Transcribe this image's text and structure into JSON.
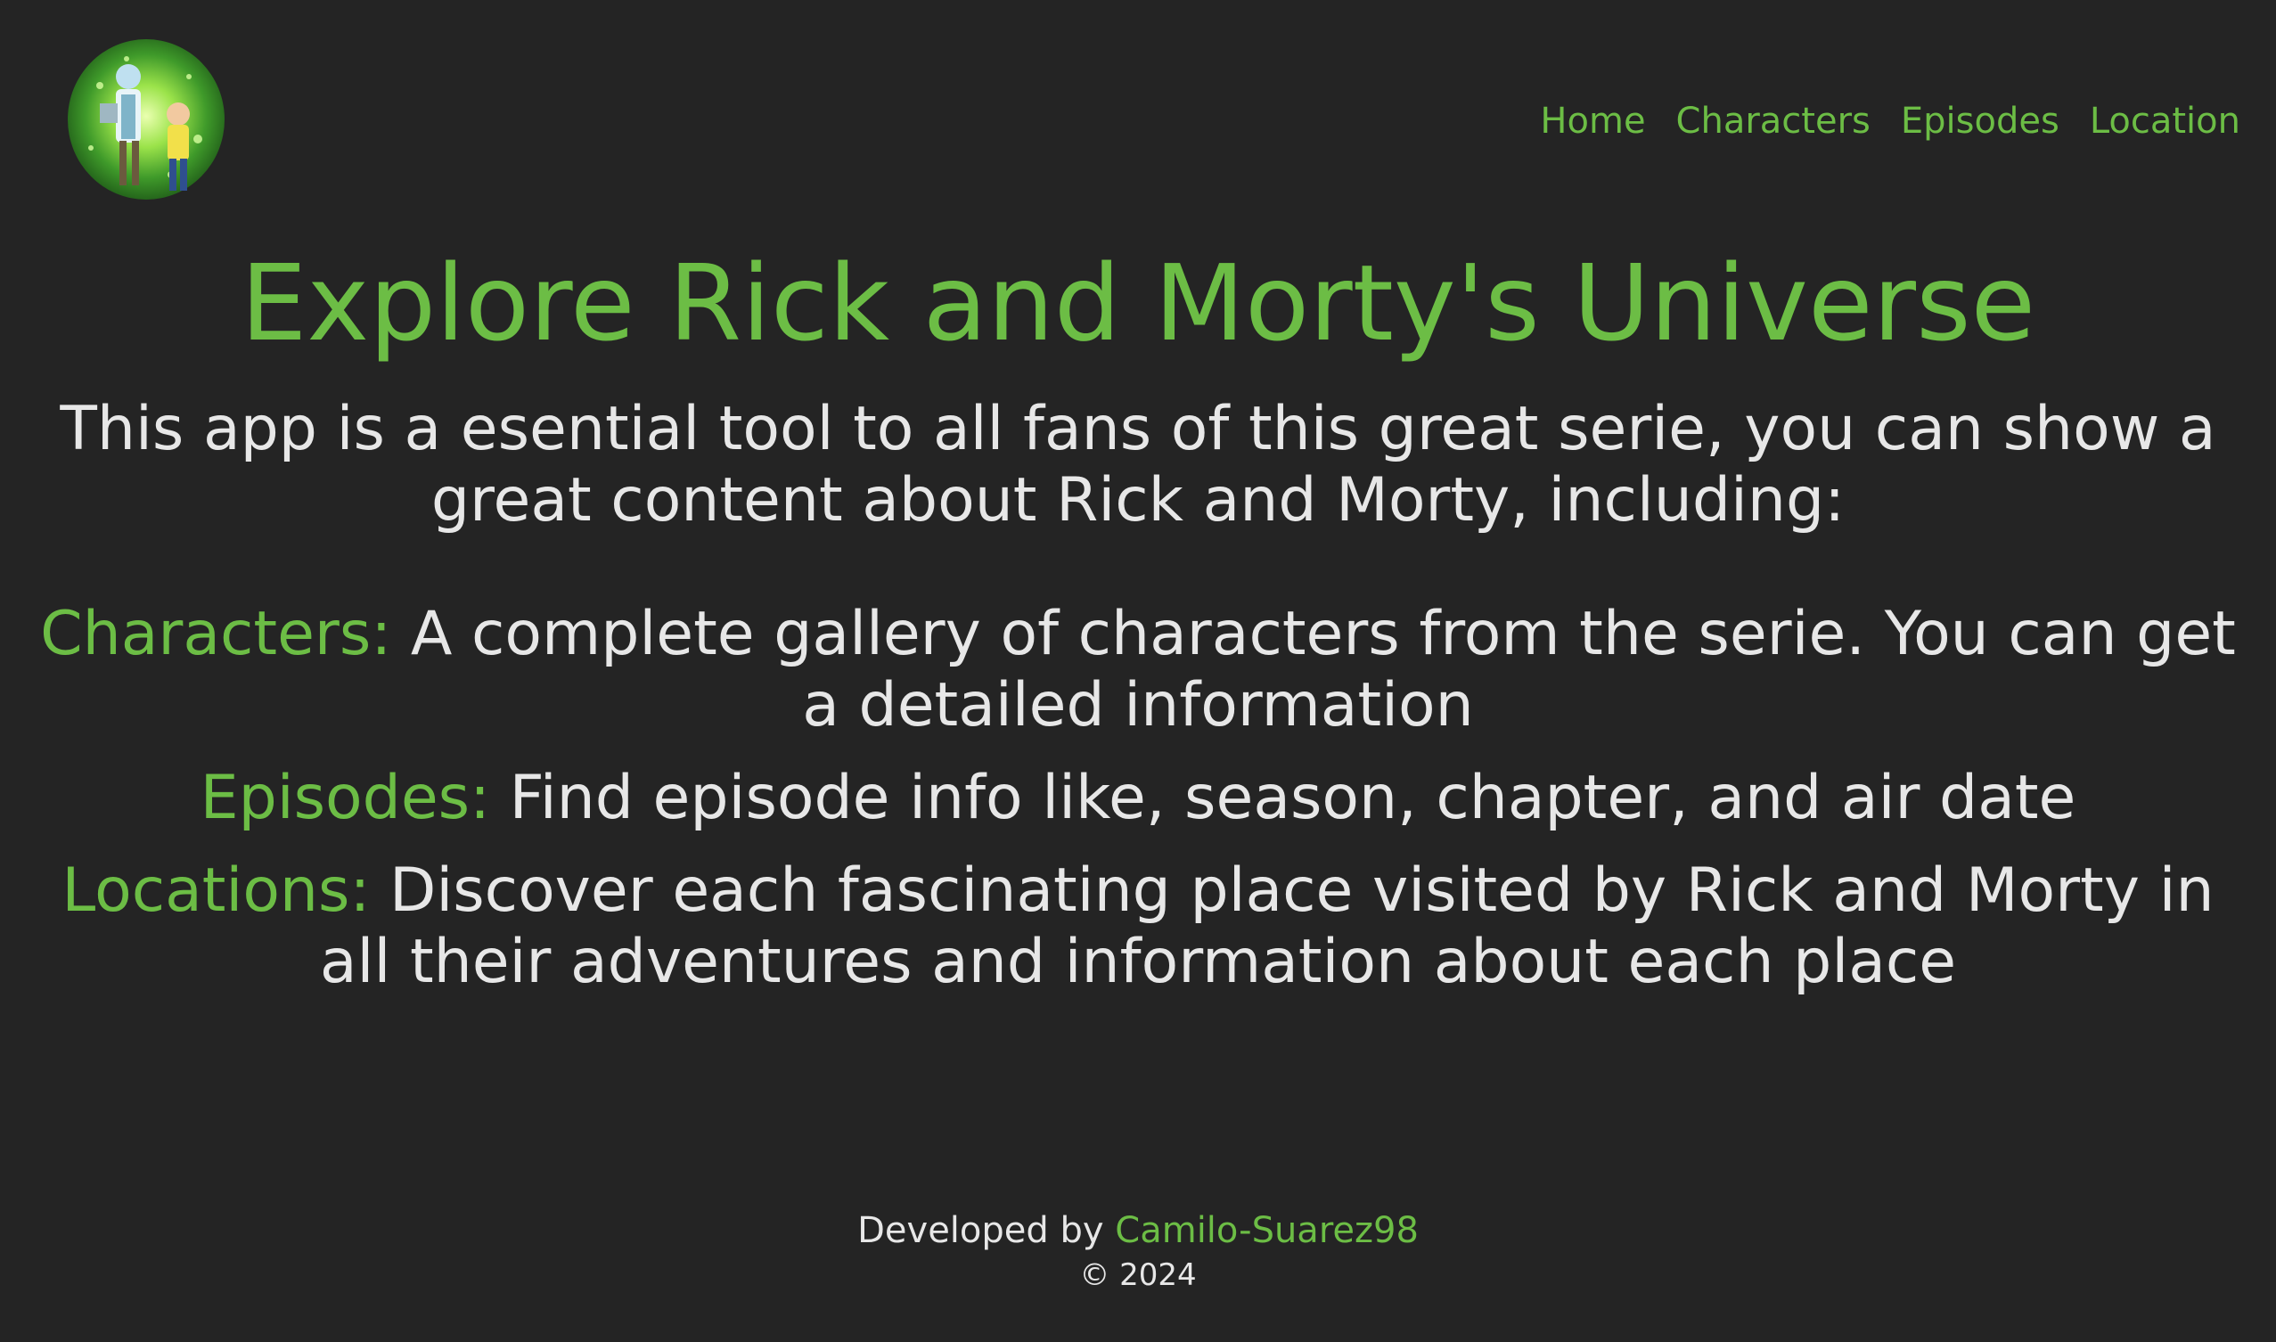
{
  "nav": {
    "items": [
      {
        "label": "Home"
      },
      {
        "label": "Characters"
      },
      {
        "label": "Episodes"
      },
      {
        "label": "Location"
      }
    ]
  },
  "hero": {
    "title": "Explore Rick and Morty's Universe",
    "intro": "This app is a esential tool to all fans of this great serie, you can show a great content about Rick and Morty, including:"
  },
  "features": [
    {
      "key": "Characters:",
      "text": "A complete gallery of characters from the serie. You can get a detailed information"
    },
    {
      "key": "Episodes:",
      "text": "Find episode info like, season, chapter, and air date"
    },
    {
      "key": "Locations:",
      "text": "Discover each fascinating place visited by Rick and Morty in all their adventures and information about each place"
    }
  ],
  "footer": {
    "developed_by": "Developed by",
    "author": "Camilo-Suarez98",
    "copyright": "© 2024"
  },
  "colors": {
    "background": "#242424",
    "accent": "#6cbd45",
    "text": "#e7e7e7"
  },
  "logo": {
    "icon": "portal-logo-icon"
  }
}
